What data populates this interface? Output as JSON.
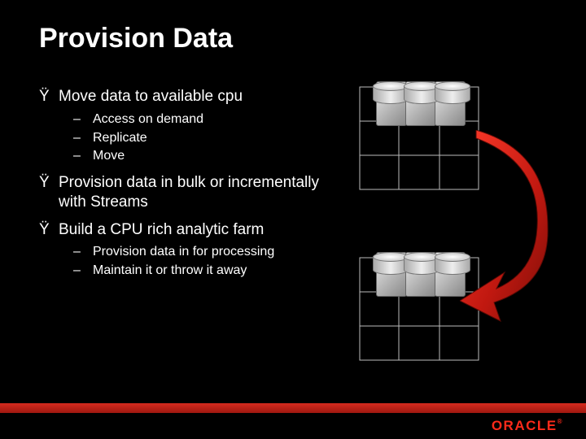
{
  "title": "Provision Data",
  "bullets": [
    {
      "level": 1,
      "marker": "Ÿ",
      "text": "Move data to available cpu"
    },
    {
      "level": 2,
      "marker": "–",
      "text": "Access on demand"
    },
    {
      "level": 2,
      "marker": "–",
      "text": "Replicate"
    },
    {
      "level": 2,
      "marker": "–",
      "text": "Move"
    },
    {
      "level": 1,
      "marker": "Ÿ",
      "text": "Provision data in bulk or incrementally with Streams"
    },
    {
      "level": 1,
      "marker": "Ÿ",
      "text": "Build a CPU rich analytic farm"
    },
    {
      "level": 2,
      "marker": "–",
      "text": "Provision data in for processing"
    },
    {
      "level": 2,
      "marker": "–",
      "text": "Maintain it or throw it away"
    }
  ],
  "logo": "ORACLE",
  "logo_suffix": "®",
  "colors": {
    "accent": "#d52b1e",
    "logo": "#ff2a1a"
  }
}
